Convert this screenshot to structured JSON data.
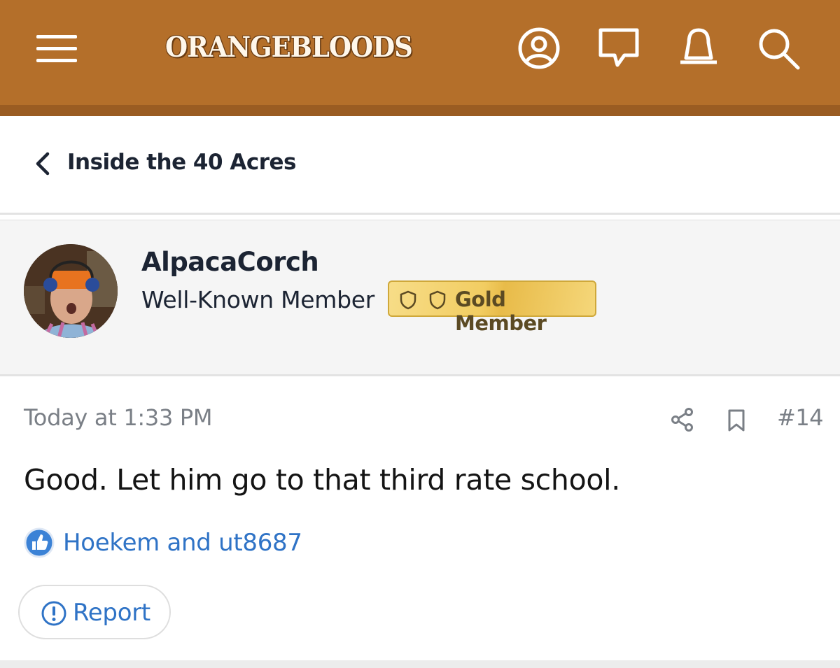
{
  "header": {
    "logo_text": "ORANGEBLOODS",
    "bg_color": "#b46f2a",
    "icons": [
      "menu-icon",
      "account-icon",
      "conversations-icon",
      "alerts-icon",
      "search-icon"
    ]
  },
  "breadcrumb": {
    "label": "Inside the 40 Acres"
  },
  "user": {
    "name": "AlpacaCorch",
    "title": "Well-Known Member",
    "badge": "Gold Member",
    "badge_color": "#f2cd62"
  },
  "post": {
    "time": "Today at 1:33 PM",
    "number": "#14",
    "body": "Good. Let him go to that third rate school.",
    "reactions": "Hoekem and ut8687",
    "report_label": "Report",
    "link_color": "#2f73c6"
  }
}
